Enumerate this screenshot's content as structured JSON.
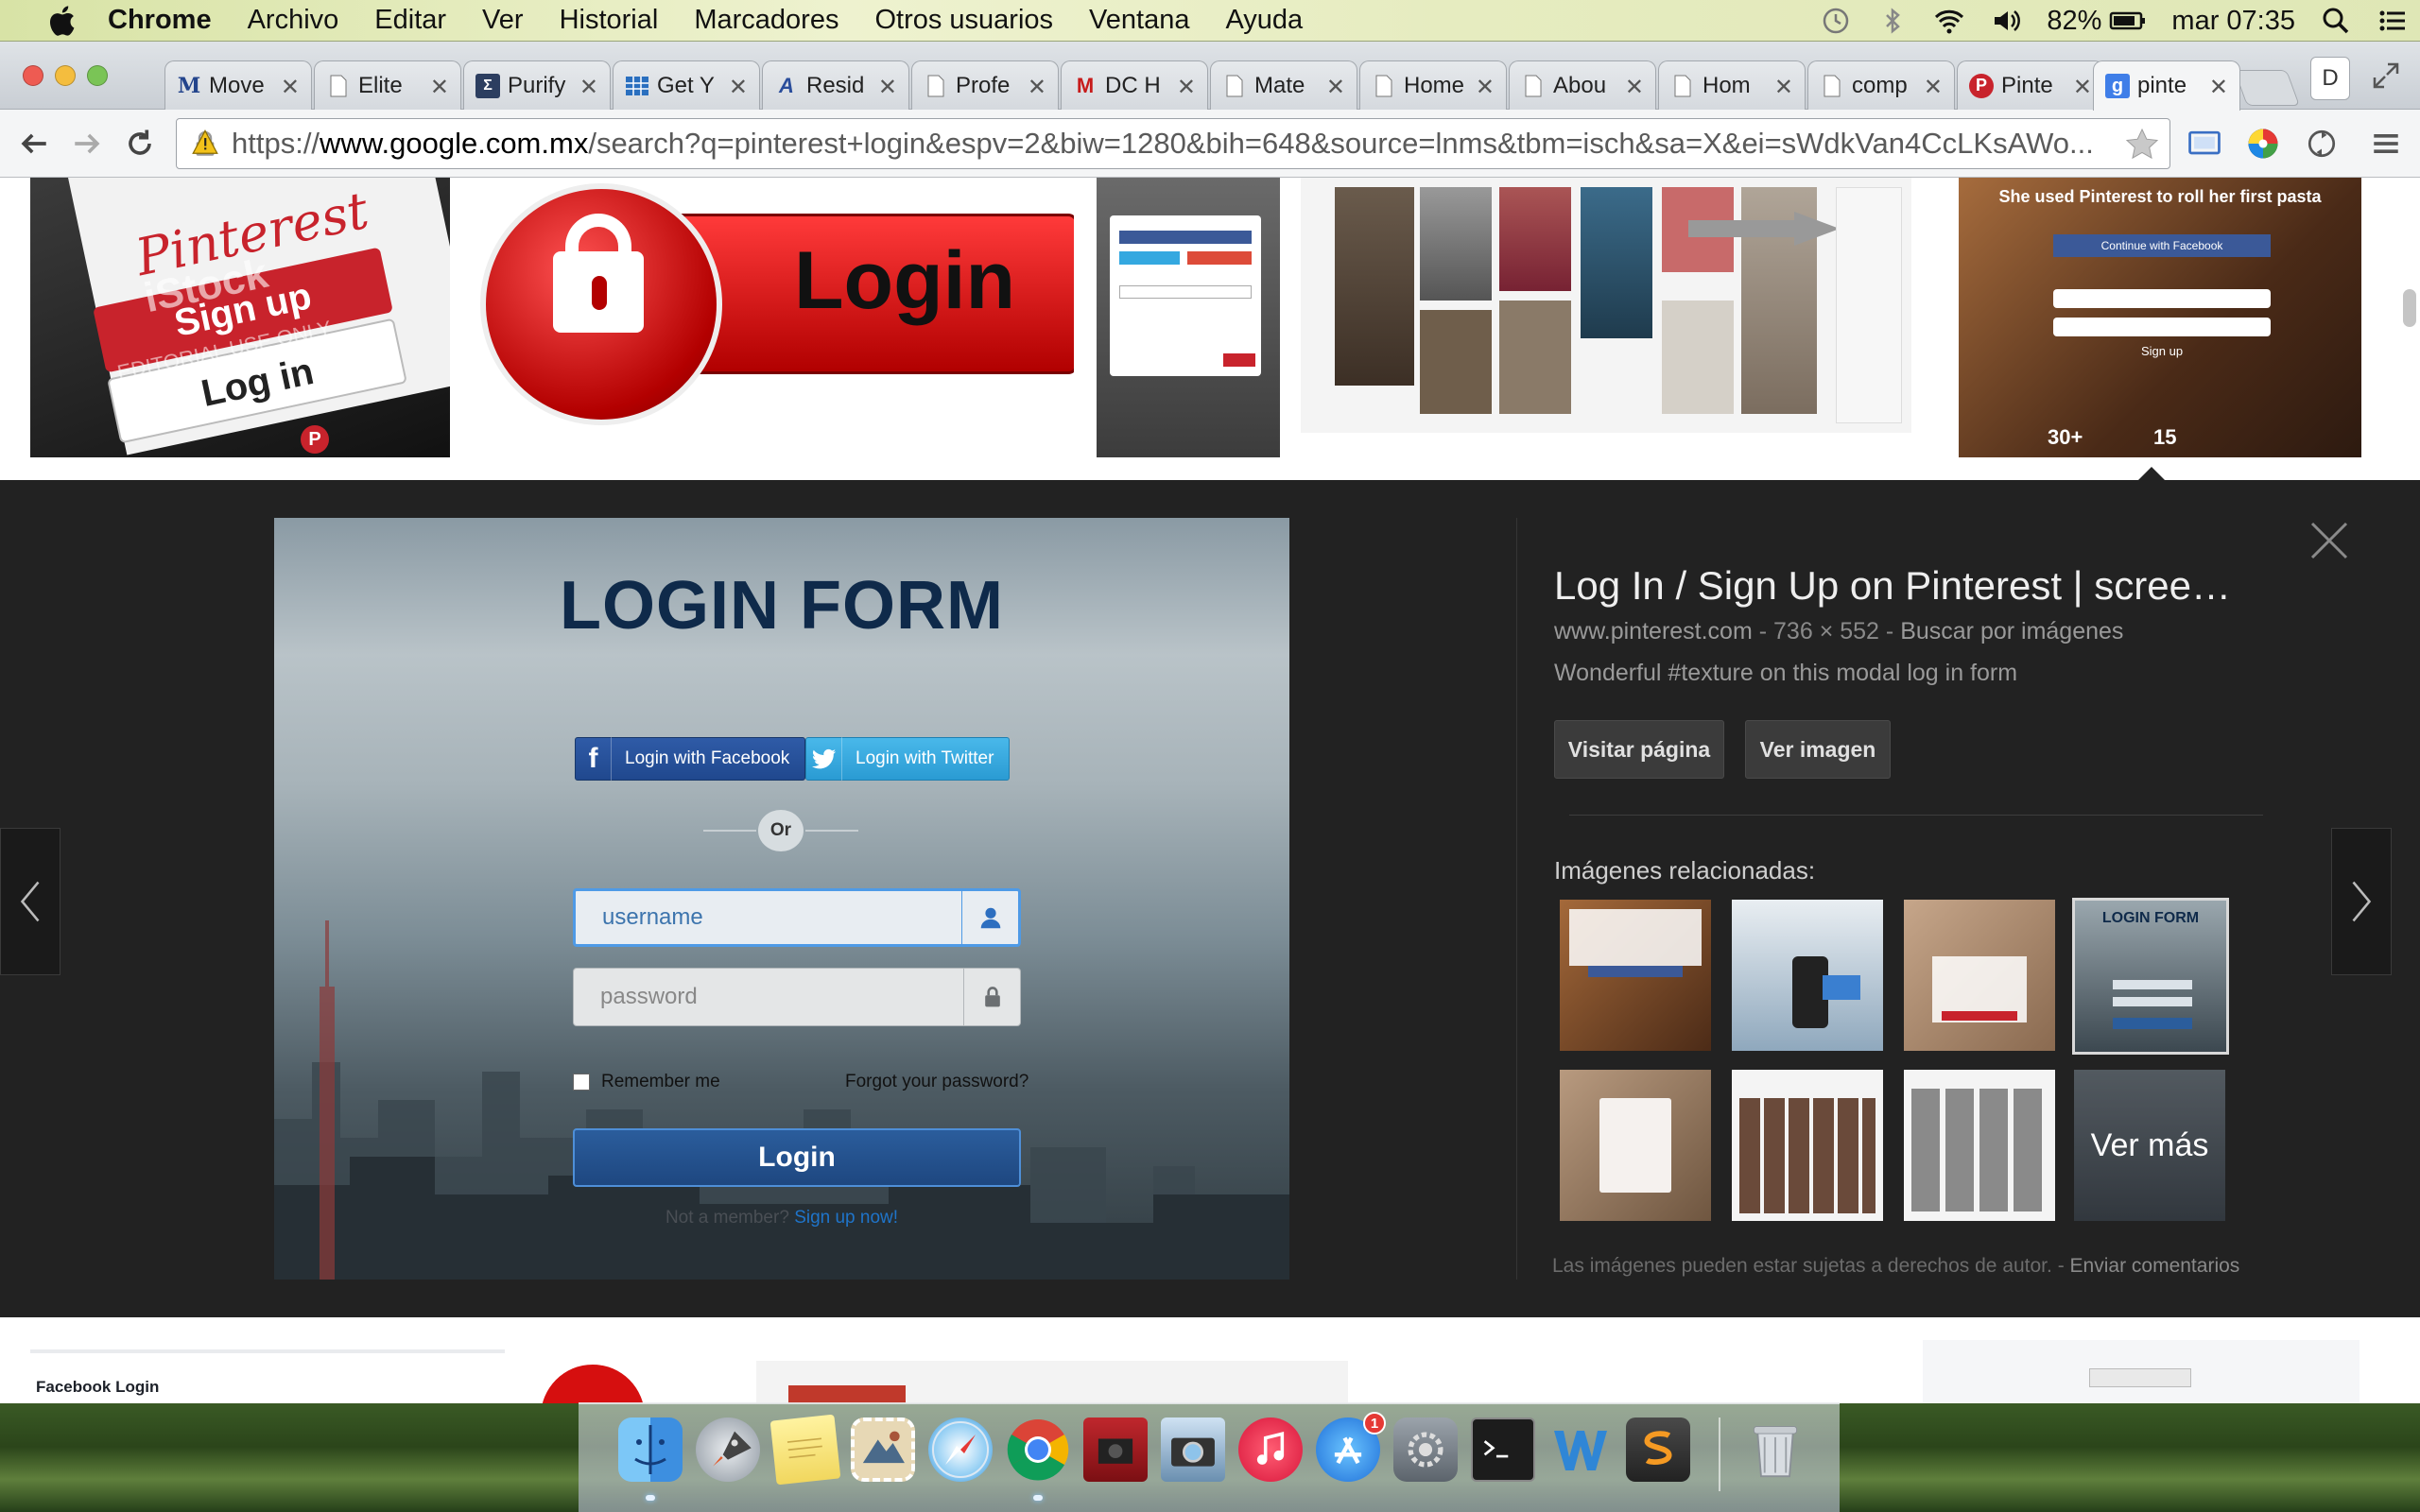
{
  "menubar": {
    "app_name": "Chrome",
    "items": [
      "Archivo",
      "Editar",
      "Ver",
      "Historial",
      "Marcadores",
      "Otros usuarios",
      "Ventana",
      "Ayuda"
    ],
    "battery": "82%",
    "clock": "mar 07:35"
  },
  "tabs": [
    {
      "title": "Move",
      "favicon": "M"
    },
    {
      "title": "Elite",
      "favicon": ""
    },
    {
      "title": "Purify",
      "favicon": ""
    },
    {
      "title": "Get Y",
      "favicon": ""
    },
    {
      "title": "Resid",
      "favicon": ""
    },
    {
      "title": "Profe",
      "favicon": ""
    },
    {
      "title": "DC H",
      "favicon": "M"
    },
    {
      "title": "Mate",
      "favicon": ""
    },
    {
      "title": "Home",
      "favicon": ""
    },
    {
      "title": "Abou",
      "favicon": ""
    },
    {
      "title": "Hom",
      "favicon": ""
    },
    {
      "title": "comp",
      "favicon": ""
    },
    {
      "title": "Pinte",
      "favicon": "P"
    },
    {
      "title": "pinte",
      "favicon": "g"
    }
  ],
  "profile_button": "D",
  "omnibox": {
    "scheme": "https://",
    "host": "www.google.com.mx",
    "path": "/search?q=pinterest+login&espv=2&biw=1280&bih=648&source=lnms&tbm=isch&sa=X&ei=sWdkVan4CcLKsAWo..."
  },
  "result_strip": {
    "pin_phone": {
      "logo": "Pinterest",
      "signup": "Sign up",
      "login": "Log in",
      "watermark": "iStock",
      "editorial": "EDITORIAL USE ONLY"
    },
    "lock_button": {
      "label": "Login"
    },
    "pasta": {
      "title": "She used Pinterest to roll her first pasta",
      "fb": "Continue with Facebook",
      "signup": "Sign up",
      "stat1": "30+",
      "stat2": "15"
    }
  },
  "preview": {
    "image": {
      "title": "LOGIN FORM",
      "fb_label": "Login with Facebook",
      "tw_label": "Login with Twitter",
      "or": "Or",
      "username_placeholder": "username",
      "password_placeholder": "password",
      "remember": "Remember me",
      "forgot": "Forgot your password?",
      "login": "Login",
      "not_member": "Not a member?",
      "signup": "Sign up now!"
    },
    "title": "Log In / Sign Up on Pinterest | scree…",
    "meta_site": "www.pinterest.com",
    "meta_size": "736 × 552",
    "meta_search": "Buscar por imágenes",
    "meta_sep": "-",
    "description": "Wonderful #texture on this modal log in form",
    "visit_button": "Visitar página",
    "view_button": "Ver imagen",
    "related_title": "Imágenes relacionadas:",
    "see_more": "Ver más",
    "related_login_title": "LOGIN FORM",
    "copyright": "Las imágenes pueden estar sujetas a derechos de autor.",
    "copyright_sep": "-",
    "feedback": "Enviar comentarios"
  },
  "bottom_strip": {
    "fb_login": "Facebook Login"
  },
  "dock": {
    "badge": "1"
  },
  "colors": {
    "preview_bg": "#222222",
    "accent_blue": "#1f74c9",
    "pinterest_red": "#c8232c",
    "facebook_blue": "#3b5998"
  }
}
